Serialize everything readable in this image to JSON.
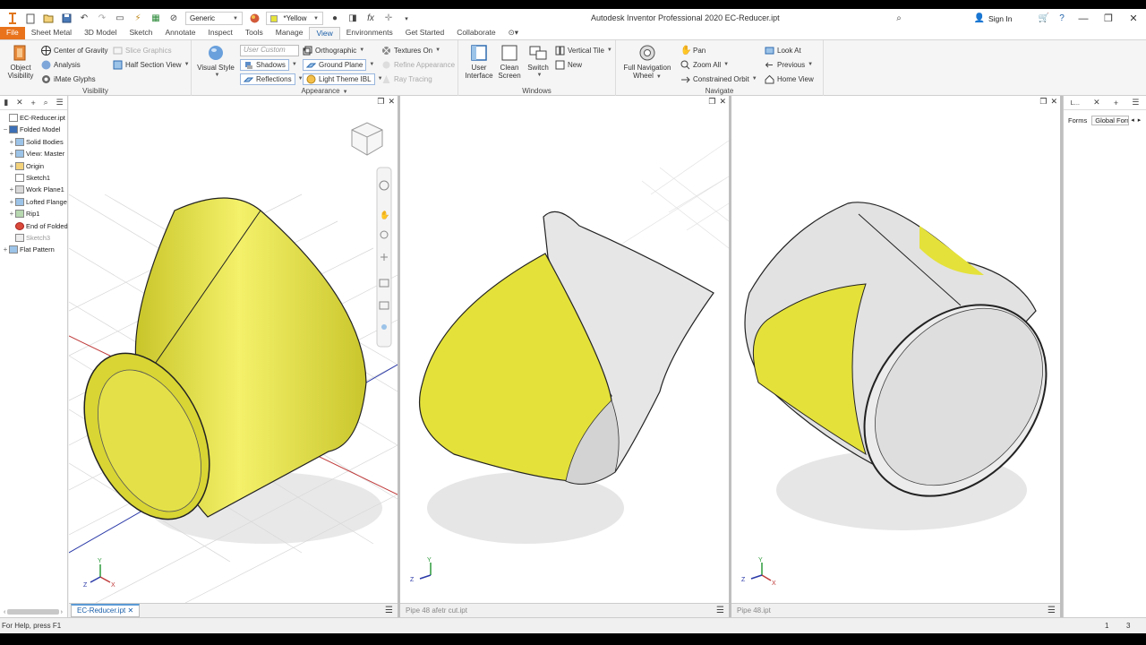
{
  "titlebar": {
    "appearance_select": "Generic",
    "color_select": "*Yellow",
    "title": "Autodesk Inventor Professional 2020   EC-Reducer.ipt",
    "signin": "Sign In"
  },
  "tabs": [
    "File",
    "Sheet Metal",
    "3D Model",
    "Sketch",
    "Annotate",
    "Inspect",
    "Tools",
    "Manage",
    "View",
    "Environments",
    "Get Started",
    "Collaborate"
  ],
  "active_tab": "View",
  "ribbon": {
    "visibility": {
      "title": "Visibility",
      "object_visibility": "Object Visibility",
      "center_of_gravity": "Center of Gravity",
      "slice_graphics": "Slice Graphics",
      "analysis": "Analysis",
      "half_section_view": "Half Section View",
      "imate_glyphs": "iMate Glyphs"
    },
    "appearance": {
      "title": "Appearance",
      "visual_style": "Visual Style",
      "user_custom": "User Custom",
      "orthographic": "Orthographic",
      "textures_on": "Textures On",
      "shadows": "Shadows",
      "ground_plane": "Ground Plane",
      "refine_appearance": "Refine Appearance",
      "reflections": "Reflections",
      "light_theme": "Light Theme IBL",
      "ray_tracing": "Ray Tracing"
    },
    "windows": {
      "title": "Windows",
      "user_interface": "User Interface",
      "clean_screen": "Clean Screen",
      "switch": "Switch",
      "vertical_tile": "Vertical Tile",
      "new": "New"
    },
    "navigate": {
      "title": "Navigate",
      "full_nav_wheel": "Full Navigation Wheel",
      "pan": "Pan",
      "zoom_all": "Zoom All",
      "constrained_orbit": "Constrained Orbit",
      "look_at": "Look At",
      "previous": "Previous",
      "home_view": "Home View"
    }
  },
  "browser": {
    "items": [
      {
        "label": "EC-Reducer.ipt",
        "indent": 0,
        "exp": ""
      },
      {
        "label": "Folded Model",
        "indent": 0,
        "exp": "−"
      },
      {
        "label": "Solid Bodies",
        "indent": 1,
        "exp": "+"
      },
      {
        "label": "View: Master",
        "indent": 1,
        "exp": "+"
      },
      {
        "label": "Origin",
        "indent": 1,
        "exp": "+"
      },
      {
        "label": "Sketch1",
        "indent": 1,
        "exp": ""
      },
      {
        "label": "Work Plane1",
        "indent": 1,
        "exp": "+"
      },
      {
        "label": "Lofted Flange",
        "indent": 1,
        "exp": "+"
      },
      {
        "label": "Rip1",
        "indent": 1,
        "exp": "+"
      },
      {
        "label": "End of Folded",
        "indent": 1,
        "exp": ""
      },
      {
        "label": "Sketch3",
        "indent": 1,
        "exp": "",
        "dim": true
      },
      {
        "label": "Flat Pattern",
        "indent": 0,
        "exp": "+"
      }
    ]
  },
  "viewports": [
    {
      "tab": "EC-Reducer.ipt"
    },
    {
      "tab": "Pipe 48 afetr cut.ipt"
    },
    {
      "tab": "Pipe 48.ipt"
    }
  ],
  "right_panel": {
    "tab_forms": "Forms",
    "tab_global": "Global Form",
    "title": "L..."
  },
  "status": {
    "help": "For Help, press F1",
    "count1": "1",
    "count2": "3"
  },
  "colors": {
    "part_yellow": "#e6e33a",
    "file_tab": "#e8731c",
    "accent": "#1a5ea8"
  }
}
